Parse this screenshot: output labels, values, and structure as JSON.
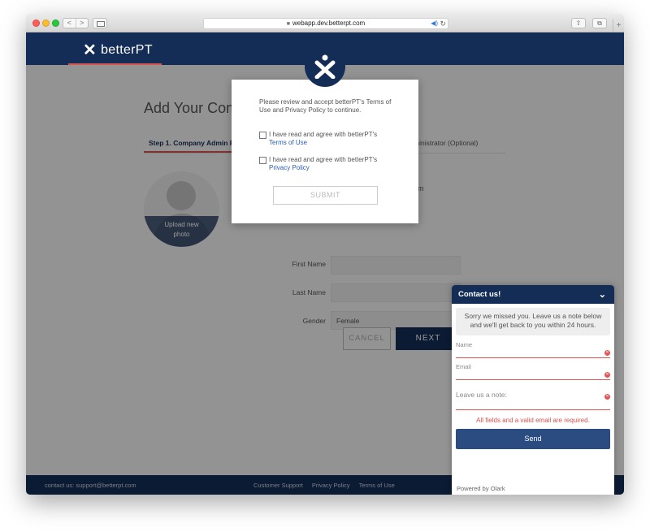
{
  "browser": {
    "url": "webapp.dev.betterpt.com",
    "nav_back": "<",
    "nav_forward": ">"
  },
  "header": {
    "brand": "betterPT"
  },
  "page": {
    "title": "Add Your Com",
    "step1": "Step 1. Company Admin Pr",
    "step2": "ministrator (Optional)",
    "side_text": "m",
    "avatar_upload": "Upload new photo",
    "first_name_label": "First Name",
    "last_name_label": "Last Name",
    "gender_label": "Gender",
    "gender_value": "Female",
    "cancel_label": "CANCEL",
    "next_label": "NEXT"
  },
  "footer": {
    "contact": "contact us: support@betterpt.com",
    "links": [
      "Customer Support",
      "Privacy Policy",
      "Terms of Use"
    ]
  },
  "modal": {
    "intro": "Please review and accept betterPT's Terms of Use and Privacy Policy to continue.",
    "agree_terms_text": "I have read and agree with betterPT's",
    "agree_terms_link": "Terms of Use",
    "agree_privacy_text": "I have read and agree with betterPT's",
    "agree_privacy_link": "Privacy Policy",
    "submit_label": "SUBMIT"
  },
  "chat": {
    "title": "Contact us!",
    "message": "Sorry we missed you. Leave us a note below and we'll get back to you within 24 hours.",
    "name_placeholder": "Name",
    "email_placeholder": "Email",
    "note_placeholder": "Leave us a note:",
    "error": "All fields and a valid email are required.",
    "send_label": "Send",
    "powered_by": "Powered by Olark"
  },
  "colors": {
    "navy": "#142d57",
    "accent_red": "#d9534f",
    "link_blue": "#2a5bb8"
  },
  "icons": [
    "lock-icon",
    "audio-icon",
    "reload-icon",
    "share-icon",
    "tabs-icon",
    "betterpt-logo-icon",
    "chevron-down-icon",
    "error-icon"
  ]
}
